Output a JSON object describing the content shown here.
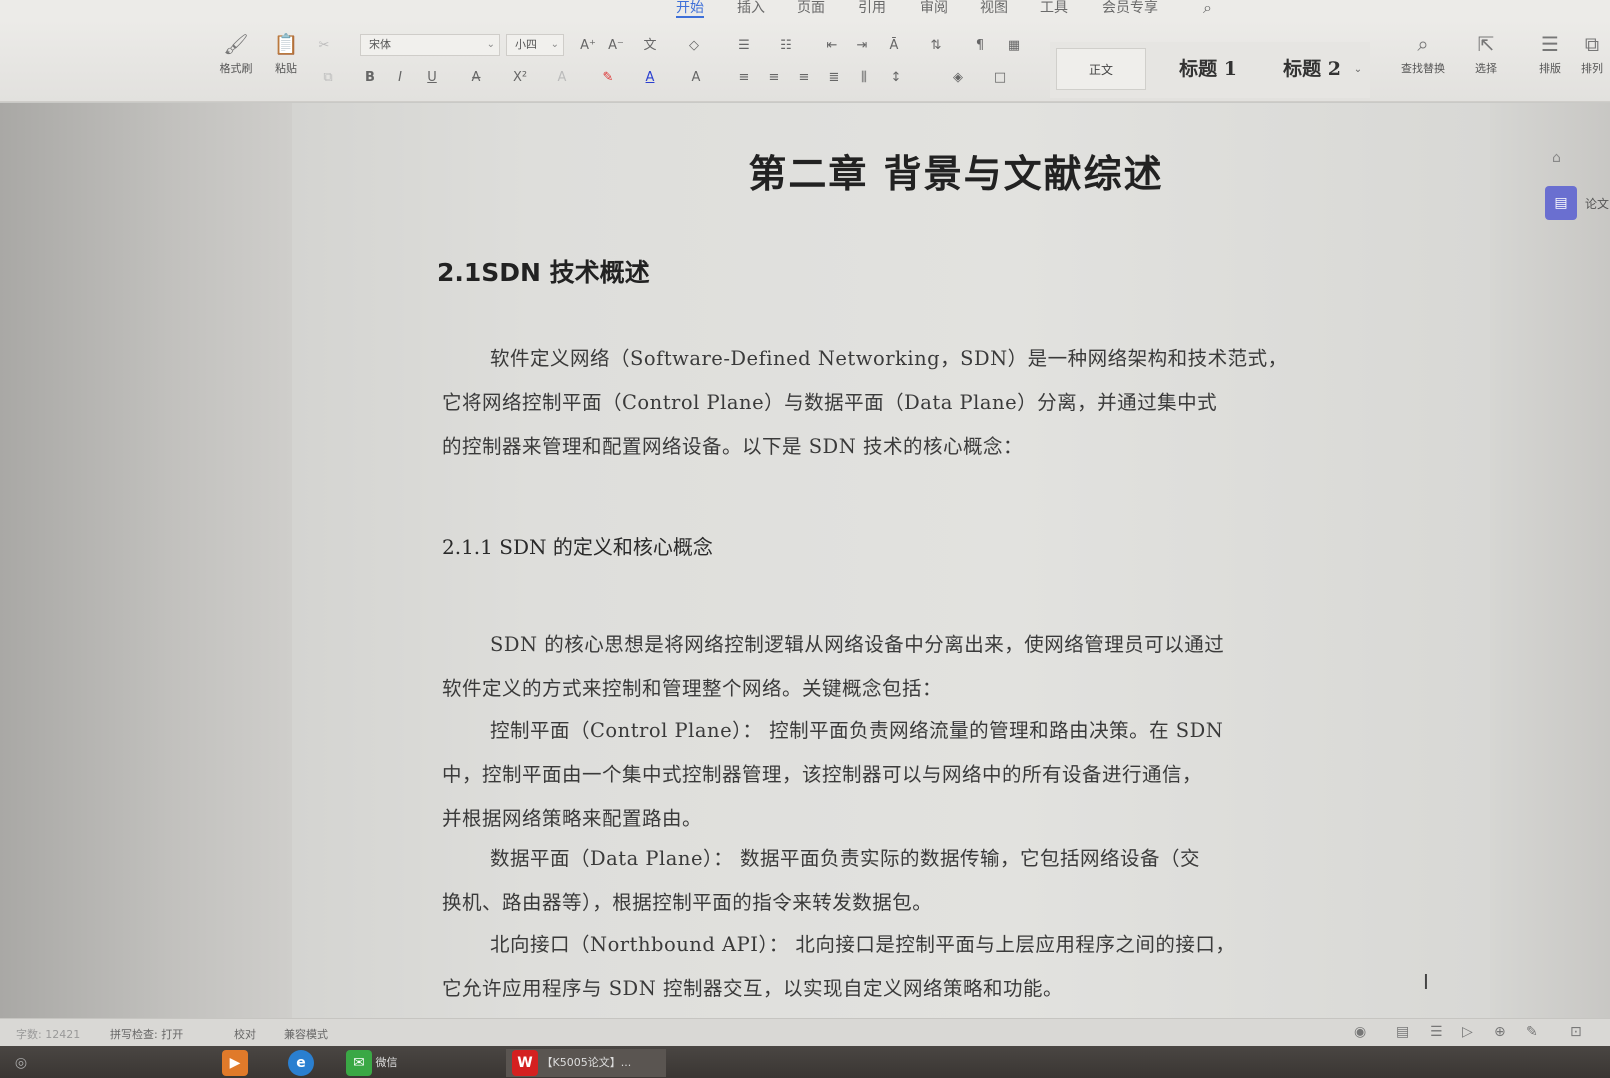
{
  "menu": {
    "tabs": [
      "开始",
      "插入",
      "页面",
      "引用",
      "审阅",
      "视图",
      "工具",
      "会员专享"
    ],
    "active_tab": "开始"
  },
  "ribbon": {
    "format_painter": "格式刷",
    "paste": "粘贴",
    "font_name": "宋体",
    "font_size": "小四",
    "styles": [
      "正文",
      "标题 1",
      "标题 2"
    ],
    "find_replace": "查找替换",
    "select": "选择",
    "layout": "排版",
    "arrange": "排列"
  },
  "document": {
    "chapter_title": "第二章    背景与文献综述",
    "section_heading": "2.1SDN 技术概述",
    "subsection_heading": "2.1.1 SDN 的定义和核心概念",
    "para1": [
      "软件定义网络（Software-Defined Networking，SDN）是一种网络架构和技术范式，",
      "它将网络控制平面（Control Plane）与数据平面（Data Plane）分离，并通过集中式",
      "的控制器来管理和配置网络设备。以下是 SDN 技术的核心概念："
    ],
    "para2": [
      "SDN 的核心思想是将网络控制逻辑从网络设备中分离出来，使网络管理员可以通过",
      "软件定义的方式来控制和管理整个网络。关键概念包括："
    ],
    "para3": [
      "控制平面（Control Plane）：  控制平面负责网络流量的管理和路由决策。在 SDN",
      "中，控制平面由一个集中式控制器管理，该控制器可以与网络中的所有设备进行通信，",
      "并根据网络策略来配置路由。"
    ],
    "para4": [
      "数据平面（Data Plane）：  数据平面负责实际的数据传输，它包括网络设备（交",
      "换机、路由器等），根据控制平面的指令来转发数据包。"
    ],
    "para5": [
      "北向接口（Northbound API）：  北向接口是控制平面与上层应用程序之间的接口，",
      "它允许应用程序与 SDN 控制器交互，以实现自定义网络策略和功能。"
    ]
  },
  "side_panel": {
    "paper_label": "论文"
  },
  "status_bar": {
    "word_count": "字数: 12421",
    "spell_check": "拼写检查: 打开",
    "proofread": "校对",
    "compat_mode": "兼容模式"
  },
  "taskbar": {
    "wechat": "微信",
    "wps_doc": "【K5005论文】..."
  },
  "colors": {
    "accent": "#3d6fd8",
    "side_button": "#6a6fd0"
  }
}
